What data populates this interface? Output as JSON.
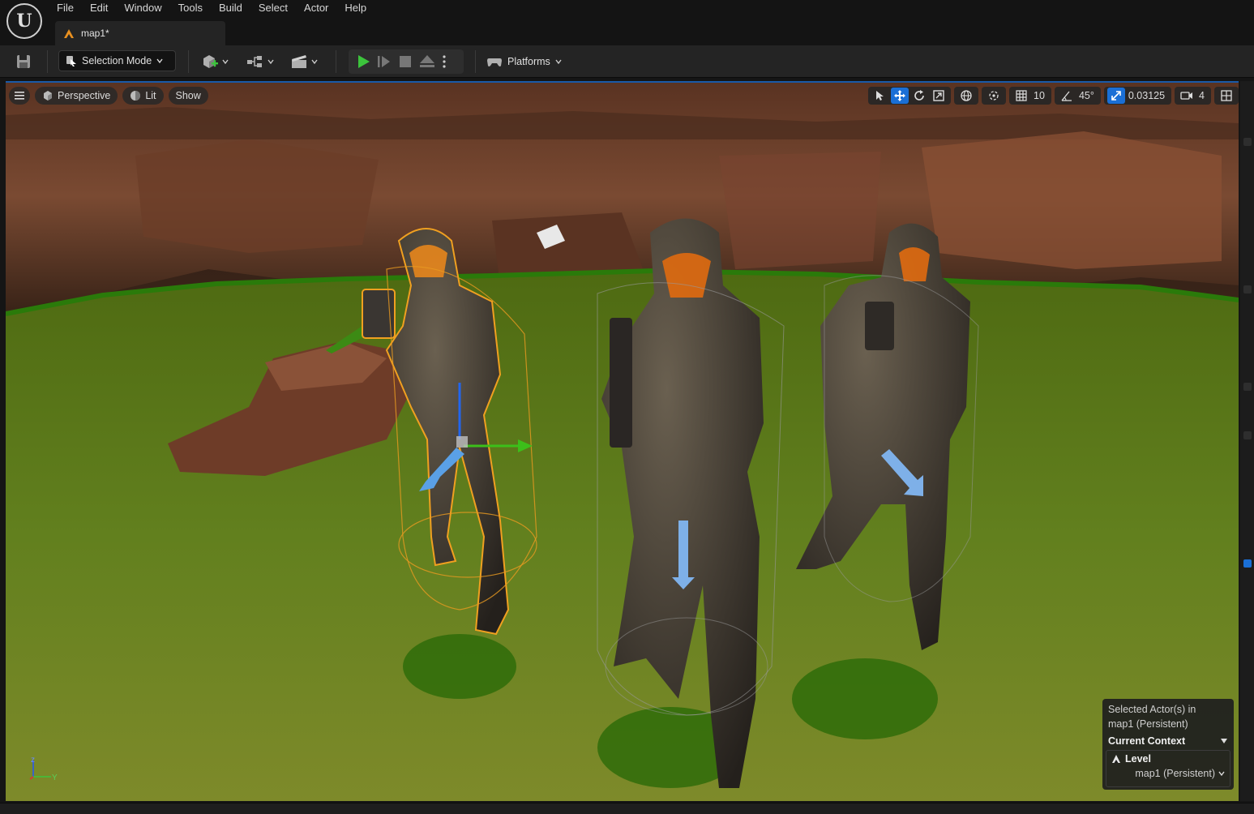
{
  "menu": [
    "File",
    "Edit",
    "Window",
    "Tools",
    "Build",
    "Select",
    "Actor",
    "Help"
  ],
  "tab": {
    "label": "map1*"
  },
  "toolbar": {
    "selection_mode": "Selection Mode",
    "platforms": "Platforms"
  },
  "viewport": {
    "perspective": "Perspective",
    "lit": "Lit",
    "show": "Show",
    "grid_snap": "10",
    "rotation_snap": "45°",
    "scale_snap": "0.03125",
    "camera_speed": "4"
  },
  "axis": {
    "z": "z",
    "y": "Y"
  },
  "context_panel": {
    "selected_line1": "Selected Actor(s) in",
    "selected_line2": "map1 (Persistent)",
    "current_context": "Current Context",
    "level_label": "Level",
    "level_value": "map1 (Persistent)"
  },
  "colors": {
    "accent": "#1a6fd6",
    "play_green": "#3cc43c",
    "selection_outline": "#f0a020",
    "ground": "#5a7a1a"
  }
}
